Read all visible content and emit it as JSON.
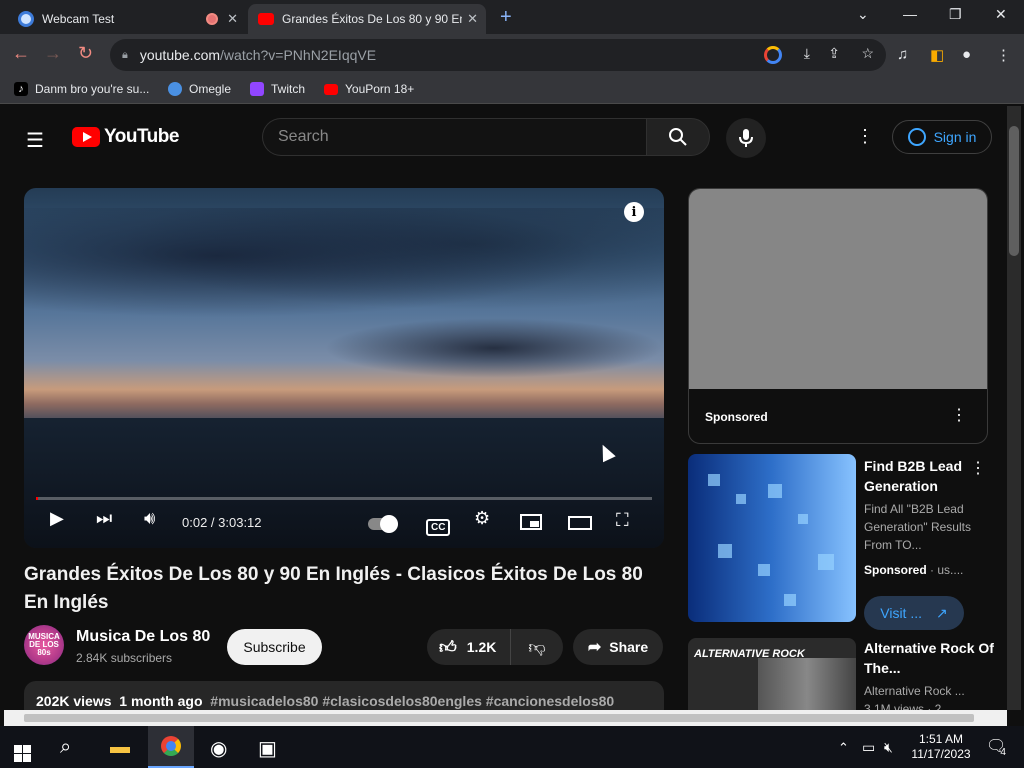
{
  "browser": {
    "tabs": [
      {
        "title": "Webcam Test"
      },
      {
        "title": "Grandes Éxitos De Los 80 y 90 En"
      }
    ],
    "url_host": "youtube.com",
    "url_path": "/watch?v=PNhN2EIqqVE",
    "bookmarks": [
      {
        "label": "Danm bro you're su..."
      },
      {
        "label": "Omegle"
      },
      {
        "label": "Twitch"
      },
      {
        "label": "YouPorn 18+"
      }
    ]
  },
  "youtube": {
    "logo_text": "YouTube",
    "search_placeholder": "Search",
    "signin_label": "Sign in"
  },
  "video": {
    "time": "0:02 / 3:03:12",
    "progress": 0.0002,
    "title": "Grandes Éxitos De Los 80 y 90 En Inglés - Clasicos Éxitos De Los 80 En Inglés",
    "channel": "Musica De Los 80",
    "channel_avatar_text": "MUSICA DE LOS 80s",
    "subscribers": "2.84K subscribers",
    "subscribe_label": "Subscribe",
    "likes": "1.2K",
    "share_label": "Share",
    "views": "202K views",
    "age": "1 month ago",
    "tags": "#musicadelos80 #clasicosdelos80engles #cancionesdelos80"
  },
  "sidebar": {
    "ad_label": "Sponsored",
    "rec1": {
      "title": "Find B2B Lead Generation",
      "desc": "Find All \"B2B Lead Generation\" Results From TO...",
      "sponsored": "Sponsored",
      "domain": "· us....",
      "visit_label": "Visit ..."
    },
    "rec2": {
      "thumb_text": "ALTERNATIVE ROCK",
      "title": "Alternative Rock Of The...",
      "channel": "Alternative Rock ...",
      "views": "3.1M views · 2..."
    }
  },
  "taskbar": {
    "time": "1:51 AM",
    "date": "11/17/2023",
    "notification_count": "4"
  }
}
